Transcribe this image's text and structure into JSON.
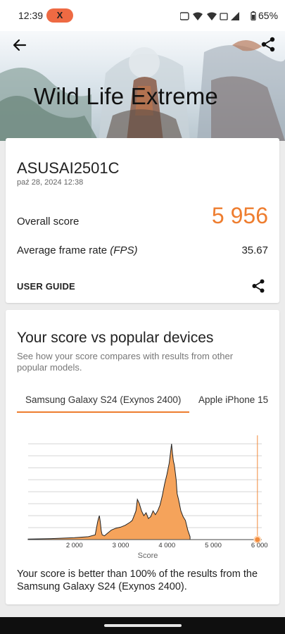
{
  "status_bar": {
    "time": "12:39",
    "app_badge": "X",
    "battery": "65%"
  },
  "header": {
    "title": "Wild Life Extreme",
    "back_icon": "back-arrow-icon",
    "share_icon": "share-icon"
  },
  "result_card": {
    "device": "ASUSAI2501C",
    "datetime": "paź 28, 2024 12:38",
    "overall_label": "Overall score",
    "overall_value": "5 956",
    "fps_label_main": "Average frame rate ",
    "fps_label_unit": "(FPS)",
    "fps_value": "35.67",
    "user_guide": "USER GUIDE",
    "accent_color": "#ee7d2f"
  },
  "comparison": {
    "title": "Your score vs popular devices",
    "description": "See how your score compares with results from other popular models.",
    "tabs": [
      "Samsung Galaxy S24 (Exynos 2400)",
      "Apple iPhone 15"
    ],
    "active_tab": 0,
    "result_text": "Your score is better than 100% of the results from the Samsung Galaxy S24 (Exynos 2400)."
  },
  "chart_data": {
    "type": "area",
    "xlabel": "Score",
    "x_ticks": [
      2000,
      3000,
      4000,
      5000,
      6000
    ],
    "x_tick_labels": [
      "2 000",
      "3 000",
      "4 000",
      "5 000",
      "6 000"
    ],
    "xlim": [
      1000,
      6050
    ],
    "ylim": [
      0,
      100
    ],
    "grid": true,
    "fill_color": "#f5a35b",
    "marker_color": "#f28b3c",
    "your_score": 5956,
    "x": [
      1000,
      1500,
      2000,
      2300,
      2450,
      2500,
      2520,
      2540,
      2560,
      2580,
      2600,
      2650,
      2700,
      2750,
      2800,
      2900,
      3000,
      3100,
      3200,
      3250,
      3300,
      3330,
      3360,
      3400,
      3450,
      3500,
      3550,
      3600,
      3650,
      3700,
      3750,
      3800,
      3850,
      3900,
      3950,
      4000,
      4050,
      4080,
      4100,
      4120,
      4140,
      4160,
      4180,
      4200,
      4220,
      4250,
      4300,
      4350,
      4400,
      4450,
      4500
    ],
    "y": [
      0.5,
      1,
      2,
      3,
      5,
      18,
      22,
      25,
      18,
      9,
      5,
      4,
      6,
      8,
      10,
      12,
      13,
      15,
      18,
      20,
      26,
      30,
      42,
      38,
      30,
      25,
      28,
      22,
      24,
      30,
      26,
      30,
      36,
      46,
      58,
      68,
      80,
      92,
      100,
      90,
      82,
      78,
      70,
      62,
      48,
      42,
      30,
      24,
      20,
      10,
      3
    ]
  }
}
